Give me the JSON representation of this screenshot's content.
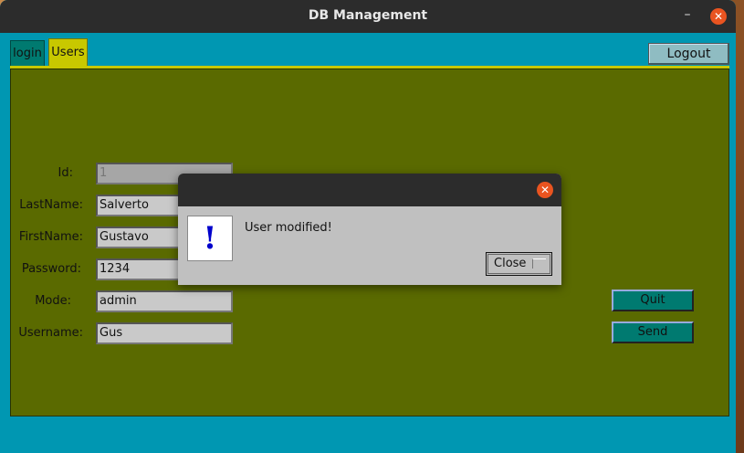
{
  "window": {
    "title": "DB Management",
    "minimize": "–",
    "close": "✕"
  },
  "tabs": [
    {
      "label": "login",
      "selected": false
    },
    {
      "label": "Users",
      "selected": true
    }
  ],
  "header": {
    "logout_label": "Logout"
  },
  "form": {
    "id": {
      "label": "Id:",
      "value": "1"
    },
    "lastname": {
      "label": "LastName:",
      "value": "Salverto"
    },
    "firstname": {
      "label": "FirstName:",
      "value": "Gustavo"
    },
    "password": {
      "label": "Password:",
      "value": "1234"
    },
    "mode": {
      "label": "Mode:",
      "value": "admin"
    },
    "username": {
      "label": "Username:",
      "value": "Gus"
    }
  },
  "actions": {
    "quit_label": "Quit",
    "send_label": "Send"
  },
  "dialog": {
    "icon_glyph": "!",
    "message": "User modified!",
    "close_label": "Close",
    "titlebar_close": "✕"
  },
  "colors": {
    "window_bg": "#0097b2",
    "panel_bg": "#5a6a00",
    "tab_selected": "#c8c800",
    "tab_unselected": "#007a70",
    "button_teal": "#007a70",
    "accent_close": "#e95420"
  }
}
